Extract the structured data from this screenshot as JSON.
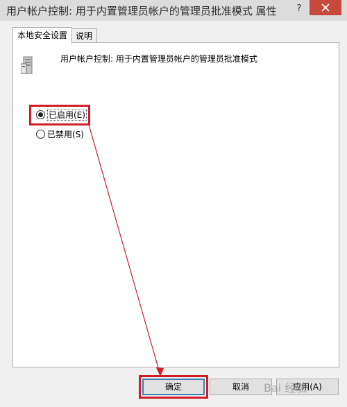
{
  "window": {
    "title": "用户帐户控制: 用于内置管理员帐户的管理员批准模式 属性",
    "help_label": "?",
    "close_label": "close"
  },
  "tabs": [
    {
      "label": "本地安全设置",
      "active": true
    },
    {
      "label": "说明",
      "active": false
    }
  ],
  "policy": {
    "icon": "server-policy-icon",
    "name": "用户帐户控制: 用于内置管理员帐户的管理员批准模式"
  },
  "options": [
    {
      "label": "已启用(E)",
      "selected": true
    },
    {
      "label": "已禁用(S)",
      "selected": false
    }
  ],
  "buttons": {
    "ok": "确定",
    "cancel": "取消",
    "apply": "应用(A)"
  },
  "annotation": {
    "color": "#d01c2a",
    "watermark": "Bai 经验"
  }
}
